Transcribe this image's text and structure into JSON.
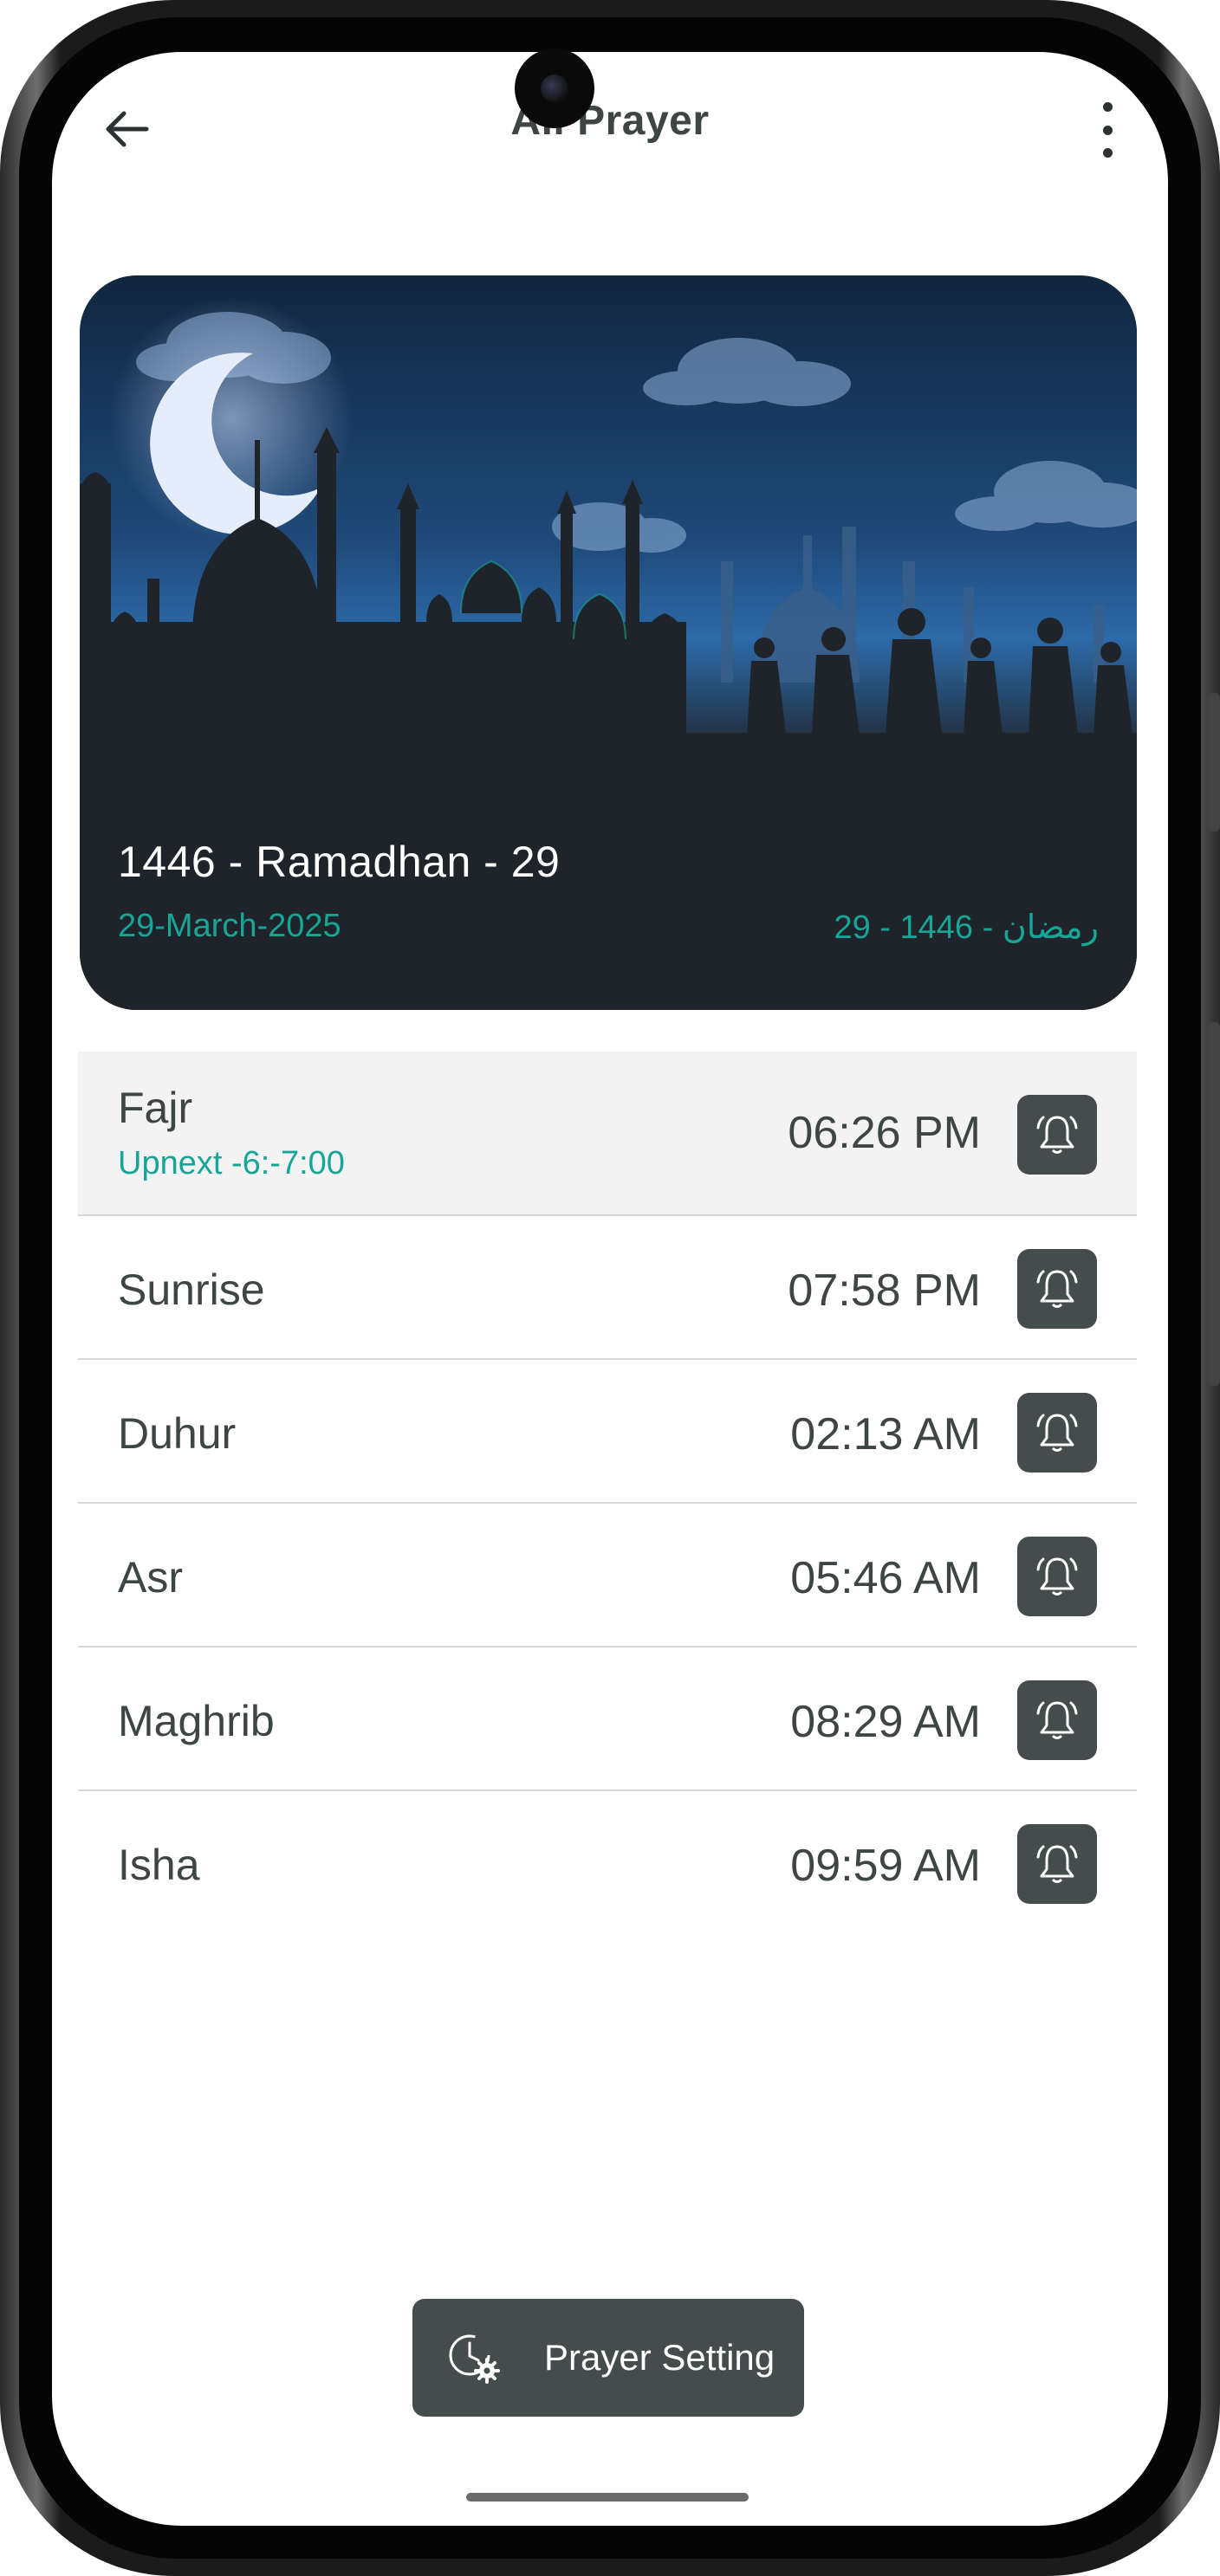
{
  "header": {
    "title": "All Prayer",
    "back_icon": "arrow-left-icon",
    "more_icon": "more-vertical-icon"
  },
  "banner": {
    "hijri_date": "1446 - Ramadhan - 29",
    "gregorian_date": "29-March-2025",
    "arabic_date": "29 - رمضان - 1446",
    "accent_color": "#16a596"
  },
  "prayers": [
    {
      "name": "Fajr",
      "time": "06:26 PM",
      "upnext": "Upnext -6:-7:00"
    },
    {
      "name": "Sunrise",
      "time": "07:58 PM"
    },
    {
      "name": "Duhur",
      "time": "02:13 AM"
    },
    {
      "name": "Asr",
      "time": "05:46 AM"
    },
    {
      "name": "Maghrib",
      "time": "08:29 AM"
    },
    {
      "name": "Isha",
      "time": "09:59 AM"
    }
  ],
  "footer": {
    "setting_label": "Prayer Setting",
    "setting_icon": "clock-gear-icon"
  },
  "colors": {
    "accent": "#16a596",
    "button": "#444d4b",
    "text": "#3d4644"
  }
}
